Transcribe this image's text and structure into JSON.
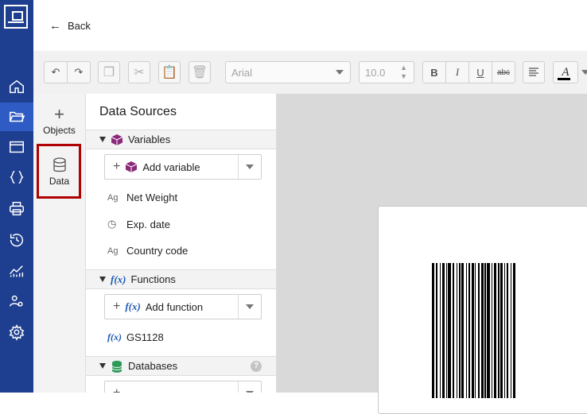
{
  "topbar": {
    "back_label": "Back"
  },
  "toolbar": {
    "font_name": "Arial",
    "font_size": "10.0",
    "bold": "B",
    "italic": "I",
    "underline": "U",
    "strikethrough": "abc"
  },
  "sidetabs": {
    "objects_label": "Objects",
    "data_label": "Data"
  },
  "panel": {
    "title": "Data Sources",
    "variables": {
      "header": "Variables",
      "add_label": "Add variable",
      "items": [
        "Net Weight",
        "Exp. date",
        "Country code"
      ]
    },
    "functions": {
      "header": "Functions",
      "add_label": "Add function",
      "items": [
        "GS1128"
      ]
    },
    "databases": {
      "header": "Databases"
    }
  },
  "colors": {
    "rail": "#1e3f8f",
    "rail_active": "#2f5bc4",
    "highlight": "#b00000",
    "variable_icon": "#8b2a7a",
    "function_icon": "#1e5ab4",
    "database_icon": "#2e9a5a"
  }
}
